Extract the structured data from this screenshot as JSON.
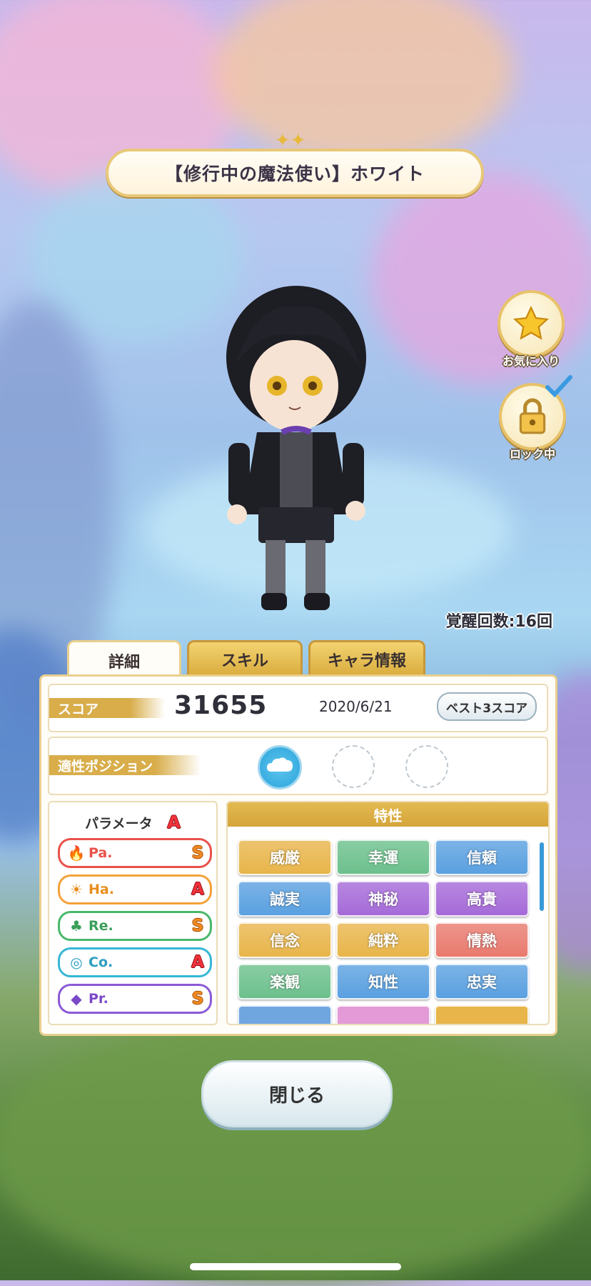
{
  "title": "【修行中の魔法使い】ホワイト",
  "side_buttons": {
    "favorite_label": "お気に入り",
    "lock_label": "ロック中"
  },
  "awakening_text": "覚醒回数:16回",
  "tabs": [
    {
      "label": "詳細",
      "active": true
    },
    {
      "label": "スキル",
      "active": false
    },
    {
      "label": "キャラ情報",
      "active": false
    }
  ],
  "score": {
    "label": "スコア",
    "value": "31655",
    "date": "2020/6/21",
    "best_button": "ベスト3スコア"
  },
  "position": {
    "label": "適性ポジション"
  },
  "parameters": {
    "title": "パラメータ",
    "overall_grade": "A",
    "items": [
      {
        "name": "Pa.",
        "grade": "S",
        "color": "#e8524a",
        "icon": "flame-icon"
      },
      {
        "name": "Ha.",
        "grade": "A",
        "color": "#f4a23a",
        "icon": "sun-icon"
      },
      {
        "name": "Re.",
        "grade": "S",
        "color": "#49b86a",
        "icon": "clover-icon"
      },
      {
        "name": "Co.",
        "grade": "A",
        "color": "#36b7d6",
        "icon": "swirl-icon"
      },
      {
        "name": "Pr.",
        "grade": "S",
        "color": "#8a5ad6",
        "icon": "gem-icon"
      }
    ]
  },
  "traits": {
    "title": "特性",
    "items": [
      {
        "label": "威厳",
        "color": "#e8b54a"
      },
      {
        "label": "幸運",
        "color": "#6cc08c"
      },
      {
        "label": "信頼",
        "color": "#5aa0e0"
      },
      {
        "label": "誠実",
        "color": "#5aa0e0"
      },
      {
        "label": "神秘",
        "color": "#a56ad8"
      },
      {
        "label": "高貴",
        "color": "#a56ad8"
      },
      {
        "label": "信念",
        "color": "#e8b54a"
      },
      {
        "label": "純粋",
        "color": "#e8b54a"
      },
      {
        "label": "情熱",
        "color": "#e97a6e"
      },
      {
        "label": "楽観",
        "color": "#6cc08c"
      },
      {
        "label": "知性",
        "color": "#5aa0e0"
      },
      {
        "label": "忠実",
        "color": "#5aa0e0"
      }
    ]
  },
  "close_button": "閉じる"
}
